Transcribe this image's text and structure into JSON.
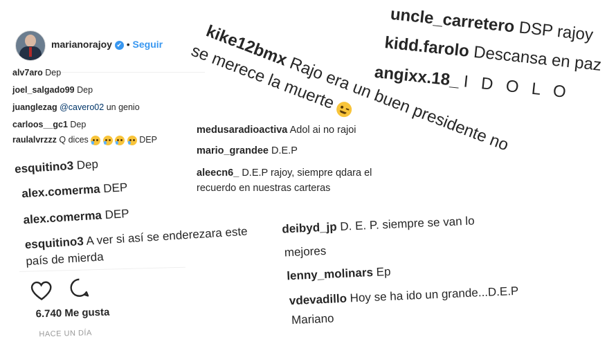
{
  "post": {
    "username": "marianorajoy",
    "verified_glyph": "✔",
    "separator": "•",
    "follow_label": "Seguir"
  },
  "comments_top": [
    {
      "user": "alv7aro",
      "text": "Dep"
    },
    {
      "user": "joel_salgado99",
      "text": "Dep"
    },
    {
      "user": "juanglezag",
      "mention": "@cavero02",
      "text": "un genio"
    },
    {
      "user": "carloos__gc1",
      "text": "Dep"
    },
    {
      "user": "raulalvrzzz",
      "text": "Q dices",
      "after": "DEP"
    }
  ],
  "comments_mid": [
    {
      "user": "esquitino3",
      "text": "Dep"
    },
    {
      "user": "alex.comerma",
      "text": "DEP"
    },
    {
      "user": "alex.comerma",
      "text": "DEP"
    },
    {
      "user": "esquitino3",
      "text": "A ver si así se enderezara este",
      "text2": "país de mierda"
    }
  ],
  "actions": {
    "likes": "6.740 Me gusta",
    "time": "HACE UN DÍA"
  },
  "comments_center": [
    {
      "user": "medusaradioactiva",
      "text": "Adol ai no rajoi"
    },
    {
      "user": "mario_grandee",
      "text": "D.E.P"
    },
    {
      "user": "aleecn6_",
      "text": "D.E.P rajoy, siempre qdara el",
      "text2": "recuerdo en nuestras carteras"
    }
  ],
  "comments_bottom": [
    {
      "user": "deibyd_jp",
      "text": "D. E. P. siempre se van lo",
      "text2": "mejores"
    },
    {
      "user": "lenny_molinars",
      "text": "Ep"
    },
    {
      "user": "vdevadillo",
      "text": "Hoy se ha ido un grande...D.E.P",
      "text2": "Mariano"
    }
  ],
  "comment_big": {
    "user": "kike12bmx",
    "text": "Rajo era un buen presidente no",
    "text2": "se merece la muerte"
  },
  "comments_topright": [
    {
      "user": "uncle_carretero",
      "text": "DSP rajoy"
    },
    {
      "user": "kidd.farolo",
      "text": "Descansa en paz"
    },
    {
      "user": "angixx.18_",
      "text": "I D O L O"
    }
  ],
  "colors": {
    "link_blue": "#3897f0",
    "mention_blue": "#003569",
    "text": "#262626",
    "muted": "#999999"
  }
}
